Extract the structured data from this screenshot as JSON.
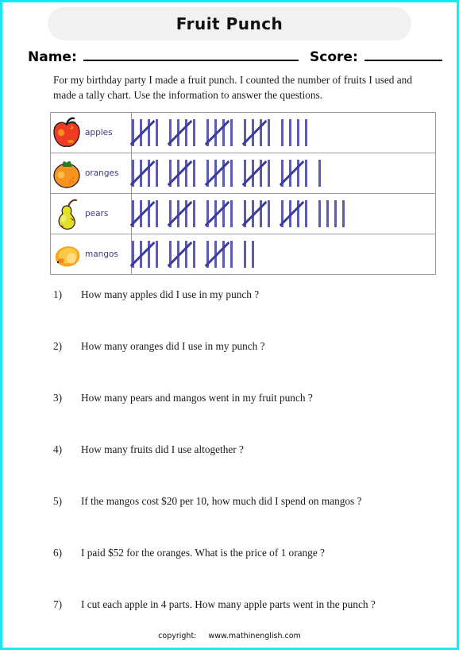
{
  "page": {
    "border_color": "#16eaf0",
    "background": "#ffffff"
  },
  "header": {
    "title": "Fruit Punch",
    "banner_color": "#f1f1f1",
    "name_label": "Name:",
    "score_label": "Score:"
  },
  "intro": {
    "text": "For my birthday party I made a fruit punch. I counted the number of fruits I used and made a tally chart. Use the information to answer the questions."
  },
  "chart_data": {
    "type": "table",
    "title": "Fruit Punch tally chart",
    "categories": [
      "apples",
      "oranges",
      "pears",
      "mangos"
    ],
    "values": [
      24,
      26,
      29,
      17
    ],
    "tally_group_size": 5,
    "rows": [
      {
        "label": "apples",
        "icon": "apple-icon",
        "count": 24,
        "fives": 4,
        "ones": 4
      },
      {
        "label": "oranges",
        "icon": "orange-icon",
        "count": 26,
        "fives": 5,
        "ones": 1
      },
      {
        "label": "pears",
        "icon": "pear-icon",
        "count": 29,
        "fives": 5,
        "ones": 4
      },
      {
        "label": "mangos",
        "icon": "mango-icon",
        "count": 17,
        "fives": 3,
        "ones": 2
      }
    ],
    "tally_bar_color": "#5b5bb0",
    "tally_slash_color": "#3b3b9e",
    "xlabel": "",
    "ylabel": "",
    "grid": true,
    "legend": "none"
  },
  "questions": [
    {
      "number": "1)",
      "text": "How many apples did I use in my punch ?"
    },
    {
      "number": "2)",
      "text": "How many oranges did I use in my punch ?"
    },
    {
      "number": "3)",
      "text": "How many pears and mangos went in my fruit punch ?"
    },
    {
      "number": "4)",
      "text": "How many fruits did I use altogether ?"
    },
    {
      "number": "5)",
      "text": "If the mangos cost $20 per 10, how much did I spend on mangos ?"
    },
    {
      "number": "6)",
      "text": "I paid $52 for the oranges. What is the price of 1 orange ?"
    },
    {
      "number": "7)",
      "text": "I cut each apple in 4 parts. How many apple parts went in the punch ?"
    }
  ],
  "footer": {
    "credit": "copyright:",
    "site": "www.mathinenglish.com"
  }
}
